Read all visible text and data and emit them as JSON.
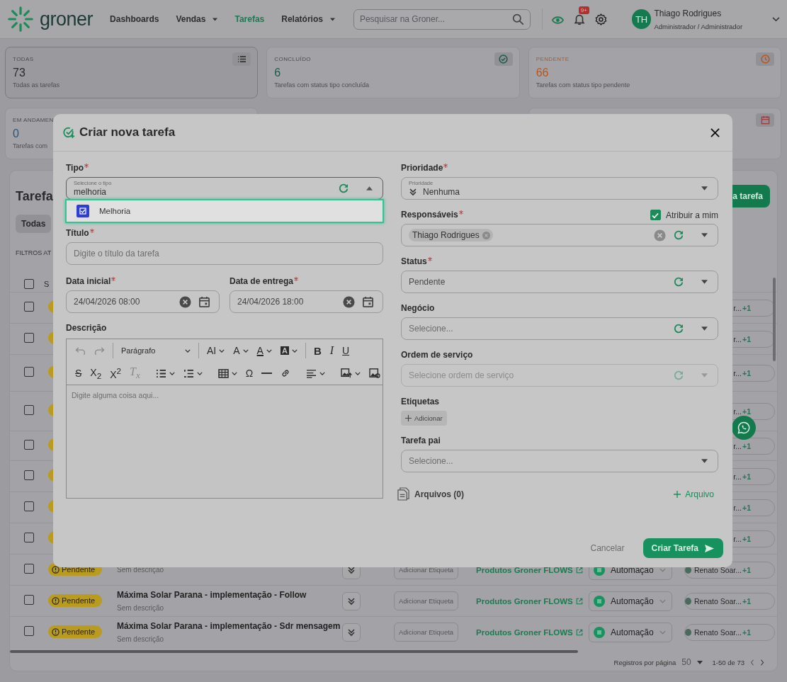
{
  "header": {
    "logo": "groner",
    "nav": [
      {
        "label": "Dashboards",
        "selected": false,
        "menu": false
      },
      {
        "label": "Vendas",
        "selected": false,
        "menu": true
      },
      {
        "label": "Tarefas",
        "selected": true,
        "menu": false
      },
      {
        "label": "Relatórios",
        "selected": false,
        "menu": true
      }
    ],
    "search": {
      "placeholder": "Pesquisar na Groner..."
    },
    "notifications_badge": "9+",
    "user": {
      "initials": "TH",
      "name": "Thiago Rodrigues",
      "role": "Administrador / Administrador"
    }
  },
  "stat_cards": [
    {
      "kind": "list",
      "label": "TODAS",
      "value": "73",
      "caption": "Todas as tarefas",
      "selected": true,
      "color": "#2b2b2d"
    },
    {
      "kind": "check",
      "label": "CONCLUÍDO",
      "value": "6",
      "caption": "Tarefas com status tipo concluída",
      "selected": false,
      "color": "#1d5a45"
    },
    {
      "kind": "clock",
      "label": "PENDENTE",
      "value": "66",
      "caption": "Tarefas com status tipo pendente",
      "selected": false,
      "color": "#b8551e"
    },
    {
      "kind": "none",
      "label": "EM ANDAMEN",
      "value": "0",
      "caption": "Tarefas com",
      "selected": false,
      "color": "#27537d"
    },
    {
      "kind": "calendar",
      "selected": false,
      "color": "#a83a3a"
    }
  ],
  "tasks": {
    "title": "Tarefa",
    "filter_chip": "Todas",
    "filters_label": "FILTROS AT",
    "new_button": "a tarefa",
    "column_1": "S",
    "header_checked": false,
    "rows": [
      {
        "kind": "covered",
        "checked": false,
        "assignee": "r...",
        "extra": "+1"
      },
      {
        "kind": "covered",
        "checked": false,
        "assignee": "r...",
        "extra": "+1"
      },
      {
        "kind": "covered",
        "checked": false,
        "assignee": "r...",
        "extra": "+1"
      },
      {
        "kind": "covered",
        "checked": false,
        "assignee": "r...",
        "extra": "+1"
      },
      {
        "kind": "covered",
        "checked": false,
        "assignee": "r...",
        "extra": "+1"
      },
      {
        "kind": "covered",
        "checked": false,
        "assignee": "r...",
        "extra": "+1"
      },
      {
        "kind": "covered",
        "checked": false,
        "assignee": "r...",
        "extra": "+1"
      },
      {
        "kind": "covered",
        "checked": false,
        "assignee": "r...",
        "extra": "+1"
      },
      {
        "kind": "full",
        "checked": false,
        "status": "Pendente",
        "description": "Sem descrição",
        "tag_placeholder": "Adicionar Etiqueta",
        "project": "Produtos Groner FLOWS",
        "category": "Automação",
        "assignee": "Renato Soar...",
        "extra": "+1"
      },
      {
        "kind": "full",
        "checked": false,
        "status": "Pendente",
        "title": "Máxima Solar Parana - implementação - Follow",
        "description": "Sem descrição",
        "tag_placeholder": "Adicionar Etiqueta",
        "project": "Produtos Groner FLOWS",
        "category": "Automação",
        "assignee": "Renato Soar...",
        "extra": "+1"
      },
      {
        "kind": "full",
        "checked": false,
        "status": "Pendente",
        "title": "Máxima Solar Parana - implementação - Sdr mensagem",
        "description": "Sem descrição",
        "tag_placeholder": "Adicionar Etiqueta",
        "project": "Produtos Groner FLOWS",
        "category": "Automação",
        "assignee": "Renato Soar...",
        "extra": "+1"
      }
    ],
    "pagination": {
      "label": "Registros por página",
      "page_size": "50",
      "range": "1-50 de 73"
    }
  },
  "modal": {
    "title": "Criar nova tarefa",
    "type_field": {
      "label": "Tipo",
      "required": true,
      "floating_label": "Selecione o tipo",
      "value": "melhoria",
      "expanded": true,
      "options": [
        {
          "label": "Melhoria",
          "selected": true
        }
      ]
    },
    "title_field": {
      "label": "Título",
      "required": true,
      "placeholder": "Digite o título da tarefa"
    },
    "dates": [
      {
        "label": "Data inicial",
        "required": true,
        "value": "24/04/2026 08:00"
      },
      {
        "label": "Data de entrega",
        "required": true,
        "value": "24/04/2026 18:00"
      }
    ],
    "description": {
      "label": "Descrição",
      "placeholder": "Digite alguma coisa aqui...",
      "toolbar_rows": [
        [
          [
            {
              "kind": "undo",
              "menu": false,
              "disabled": true
            },
            {
              "kind": "redo",
              "menu": false,
              "disabled": true
            }
          ],
          [
            {
              "kind": "style",
              "glyph": "Parágrafo",
              "menu": true,
              "disabled": false
            }
          ],
          [
            {
              "kind": "text",
              "glyph": "AI",
              "menu": true,
              "disabled": false
            },
            {
              "kind": "text",
              "glyph": "A",
              "menu": true,
              "disabled": false
            },
            {
              "kind": "color",
              "glyph": "A",
              "menu": true,
              "disabled": false
            },
            {
              "kind": "highlight",
              "glyph": "A",
              "menu": true,
              "disabled": false
            }
          ],
          [
            {
              "kind": "bold",
              "glyph": "B",
              "menu": false,
              "disabled": false
            },
            {
              "kind": "italic",
              "glyph": "I",
              "menu": false,
              "disabled": false
            },
            {
              "kind": "underline",
              "glyph": "U",
              "menu": false,
              "disabled": false
            }
          ]
        ],
        [
          [
            {
              "kind": "strike",
              "glyph": "S",
              "menu": false,
              "disabled": false
            },
            {
              "kind": "text",
              "glyph": "X$_{2}$",
              "menu": false,
              "disabled": false
            },
            {
              "kind": "text",
              "glyph": "X$^{2}$",
              "menu": false,
              "disabled": false
            },
            {
              "kind": "clear",
              "glyph": "T$_{x}$",
              "menu": false,
              "disabled": true
            }
          ],
          [
            {
              "kind": "bullets",
              "menu": true,
              "disabled": false
            },
            {
              "kind": "numbers",
              "menu": true,
              "disabled": false
            }
          ],
          [
            {
              "kind": "table",
              "menu": true,
              "disabled": false
            },
            {
              "kind": "text",
              "glyph": "Ω",
              "menu": false,
              "disabled": false
            },
            {
              "kind": "rule",
              "menu": false,
              "disabled": false
            },
            {
              "kind": "link",
              "menu": false,
              "disabled": false
            }
          ],
          [
            {
              "kind": "align",
              "menu": true,
              "disabled": false
            }
          ],
          [
            {
              "kind": "image",
              "menu": true,
              "disabled": false
            },
            {
              "kind": "image-edit",
              "menu": false,
              "disabled": false
            }
          ]
        ]
      ]
    },
    "right_fields": [
      {
        "kind": "priority",
        "label": "Prioridade",
        "required": true,
        "floating_label": "Prioridade",
        "value": "Nenhuma",
        "refresh": false,
        "disabled": false
      },
      {
        "kind": "people",
        "label": "Responsáveis",
        "required": true,
        "assign_to_me": {
          "label": "Atribuir a mim",
          "checked": true
        },
        "chips": [
          "Thiago Rodrigues"
        ],
        "refresh": true,
        "disabled": false
      },
      {
        "kind": "select",
        "label": "Status",
        "required": true,
        "value": "Pendente",
        "refresh": true,
        "disabled": false
      },
      {
        "kind": "select",
        "label": "Negócio",
        "required": false,
        "placeholder": "Selecione...",
        "refresh": true,
        "disabled": false
      },
      {
        "kind": "select",
        "label": "Ordem de serviço",
        "required": false,
        "placeholder": "Selecione ordem de serviço",
        "refresh": true,
        "disabled": true
      },
      {
        "kind": "tags",
        "label": "Etiquetas",
        "required": false,
        "add": "Adicionar"
      },
      {
        "kind": "select",
        "label": "Tarefa pai",
        "required": false,
        "placeholder": "Selecione...",
        "refresh": false,
        "disabled": false
      }
    ],
    "files": {
      "label": "Arquivos (0)",
      "add": "Arquivo"
    },
    "cancel": "Cancelar",
    "submit": "Criar Tarefa"
  }
}
